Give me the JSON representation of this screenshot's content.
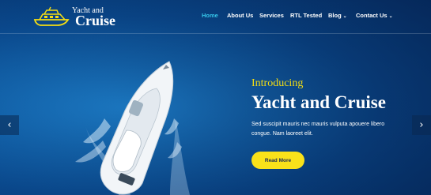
{
  "brand": {
    "line1": "Yacht and",
    "line2": "Cruise",
    "icon": "yacht-logo-icon",
    "accent_color": "#f4dd13"
  },
  "nav": {
    "items": [
      {
        "label": "Home",
        "active": true
      },
      {
        "label": "About Us"
      },
      {
        "label": "Services"
      },
      {
        "label": "RTL Tested"
      },
      {
        "label": "Blog",
        "dropdown": true
      },
      {
        "label": "Contact Us",
        "dropdown": true
      }
    ],
    "active_color": "#35c4e8",
    "dropdown_icon": "chevron-down-icon"
  },
  "slider": {
    "prev_icon": "chevron-left-icon",
    "next_icon": "chevron-right-icon",
    "prev_glyph": "‹",
    "next_glyph": "›"
  },
  "hero": {
    "intro": "Introducing",
    "title": "Yacht and Cruise",
    "description": "Sed suscipit mauris nec mauris vulputa apouere libero congue. Nam laoreet elit.",
    "button_label": "Read More",
    "button_color": "#f9e21a",
    "image": "yacht-aerial-photo"
  }
}
